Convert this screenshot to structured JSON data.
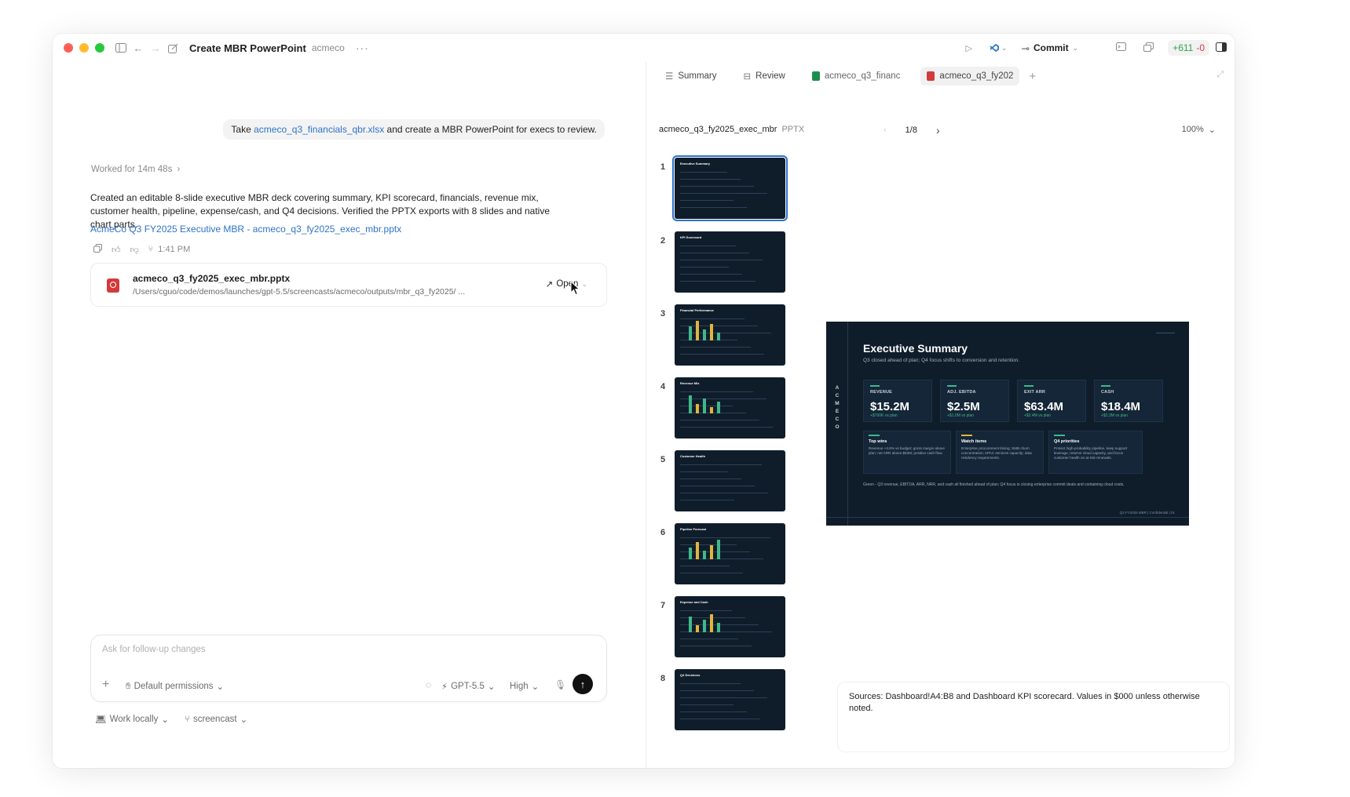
{
  "window": {
    "title": "Create MBR PowerPoint",
    "project": "acmeco",
    "commit_label": "Commit",
    "diff_added": "+611",
    "diff_removed": "-0"
  },
  "chat": {
    "prompt_prefix": "Take ",
    "prompt_file": "acmeco_q3_financials_qbr.xlsx",
    "prompt_suffix": " and create a MBR PowerPoint for execs to review.",
    "worked_for": "Worked for 14m 48s",
    "response": "Created an editable 8-slide executive MBR deck covering summary, KPI scorecard, financials, revenue mix, customer health, pipeline, expense/cash, and Q4 decisions. Verified the PPTX exports with 8 slides and native chart parts.",
    "response_link": "AcmeCo Q3 FY2025 Executive MBR - acmeco_q3_fy2025_exec_mbr.pptx",
    "time": "1:41 PM",
    "file": {
      "name": "acmeco_q3_fy2025_exec_mbr.pptx",
      "path": "/Users/cguo/code/demos/launches/gpt-5.5/screencasts/acmeco/outputs/mbr_q3_fy2025/ ...",
      "open_label": "Open"
    }
  },
  "composer": {
    "placeholder": "Ask for follow-up changes",
    "permissions": "Default permissions",
    "model": "GPT-5.5",
    "effort": "High",
    "work_mode": "Work locally",
    "branch": "screencast"
  },
  "viewer": {
    "tabs": [
      {
        "label": "Summary"
      },
      {
        "label": "Review"
      },
      {
        "label": "acmeco_q3_financ"
      },
      {
        "label": "acmeco_q3_fy202"
      }
    ],
    "filename": "acmeco_q3_fy2025_exec_mbr",
    "filetype": "PPTX",
    "page": "1/8",
    "zoom": "100%",
    "thumb_numbers": [
      "1",
      "2",
      "3",
      "4",
      "5",
      "6",
      "7",
      "8"
    ],
    "thumb_titles": [
      "Executive Summary",
      "KPI Scorecard",
      "Financial Performance",
      "Revenue Mix",
      "Customer Health",
      "Pipeline Forecast",
      "Expense and Cash",
      "Q4 Decisions"
    ],
    "sources": "Sources: Dashboard!A4:B8 and Dashboard KPI scorecard. Values in $000 unless otherwise noted."
  },
  "slide": {
    "side_label": "ACMECO",
    "title": "Executive Summary",
    "subtitle": "Q3 closed ahead of plan; Q4 focus shifts to conversion and retention.",
    "kpis": [
      {
        "label": "REVENUE",
        "value": "$15.2M",
        "sub": "+$700K vs plan"
      },
      {
        "label": "ADJ. EBITDA",
        "value": "$2.5M",
        "sub": "+$1.0M vs plan"
      },
      {
        "label": "EXIT ARR",
        "value": "$63.4M",
        "sub": "+$2.4M vs plan"
      },
      {
        "label": "CASH",
        "value": "$18.4M",
        "sub": "+$2.3M vs plan"
      }
    ],
    "cards": [
      {
        "title": "Top wins",
        "text": "Revenue +4.8% vs budget; gross margin above plan; net ARR above $63M; positive cash flow."
      },
      {
        "title": "Watch items",
        "text": "Enterprise procurement timing; SMB churn concentration; APAC services capacity; data residency requirements."
      },
      {
        "title": "Q4 priorities",
        "text": "Protect high-probability pipeline, keep support leverage, reserve cloud capacity, and focus customer health on at-risk renewals."
      }
    ],
    "footer_note": "Green - Q3 revenue, EBITDA, ARR, NRR, and cash all finished ahead of plan; Q4 focus is closing enterprise commit deals and containing cloud costs.",
    "footer_right": "Q3 FY2025 MBR  |  Confidential  |  01"
  },
  "colors": {
    "accent": "#2e73c9",
    "slide_bg": "#0f1d2b",
    "kpi_green": "#3fb98a",
    "diff_green": "#2ea44f",
    "diff_red": "#d73a49"
  }
}
